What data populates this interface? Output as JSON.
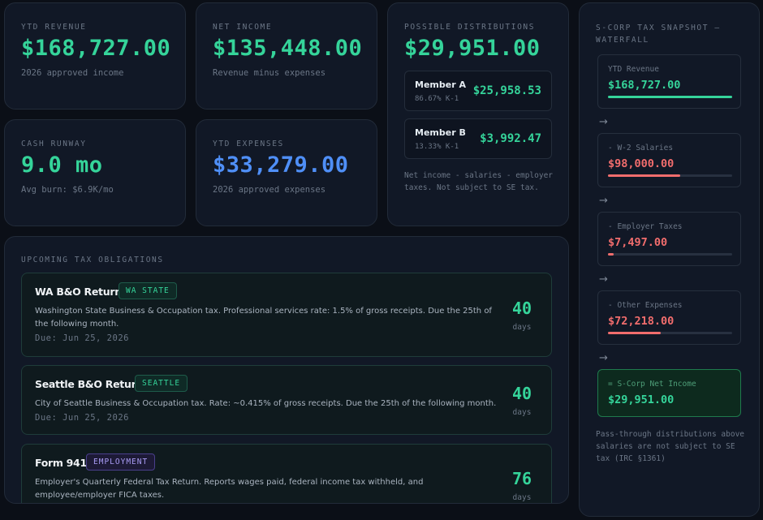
{
  "ytd_revenue": {
    "label": "YTD REVENUE",
    "value": "$168,727.00",
    "sub": "2026 approved income"
  },
  "net_income": {
    "label": "NET INCOME",
    "value": "$135,448.00",
    "sub": "Revenue minus expenses"
  },
  "cash_runway": {
    "label": "CASH RUNWAY",
    "value": "9.0 mo",
    "sub": "Avg burn: $6.9K/mo"
  },
  "ytd_expenses": {
    "label": "YTD EXPENSES",
    "value": "$33,279.00",
    "sub": "2026 approved expenses"
  },
  "distributions": {
    "label": "POSSIBLE DISTRIBUTIONS",
    "value": "$29,951.00",
    "members": [
      {
        "name": "Member A",
        "pct": "86.67% K-1",
        "amount": "$25,958.53"
      },
      {
        "name": "Member B",
        "pct": "13.33% K-1",
        "amount": "$3,992.47"
      }
    ],
    "note": "Net income - salaries - employer taxes. Not subject to SE tax."
  },
  "obligations": {
    "label": "UPCOMING TAX OBLIGATIONS",
    "items": [
      {
        "title": "WA B&O Return",
        "badge": "WA STATE",
        "desc": "Washington State Business & Occupation tax. Professional services rate: 1.5% of gross receipts. Due the 25th of the following month.",
        "due": "Due: Jun 25, 2026",
        "days": "40",
        "days_label": "days"
      },
      {
        "title": "Seattle B&O Return",
        "badge": "SEATTLE",
        "desc": "City of Seattle Business & Occupation tax. Rate: ~0.415% of gross receipts. Due the 25th of the following month.",
        "due": "Due: Jun 25, 2026",
        "days": "40",
        "days_label": "days"
      },
      {
        "title": "Form 941",
        "badge": "EMPLOYMENT",
        "desc": "Employer's Quarterly Federal Tax Return. Reports wages paid, federal income tax withheld, and employee/employer FICA taxes.",
        "due": "",
        "days": "76",
        "days_label": "days"
      }
    ]
  },
  "waterfall": {
    "title": "S-CORP TAX SNAPSHOT — WATERFALL",
    "arrow": "→",
    "steps": [
      {
        "label": "YTD Revenue",
        "value": "$168,727.00",
        "fraction": 1.0,
        "color": "#35d49a"
      },
      {
        "label": "- W-2 Salaries",
        "value": "$98,000.00",
        "fraction": 0.581,
        "color": "#f26d6d"
      },
      {
        "label": "- Employer Taxes",
        "value": "$7,497.00",
        "fraction": 0.044,
        "color": "#f26d6d"
      },
      {
        "label": "- Other Expenses",
        "value": "$72,218.00",
        "fraction": 0.428,
        "color": "#f26d6d"
      }
    ],
    "final": {
      "label": "= S-Corp Net Income",
      "value": "$29,951.00"
    },
    "note": "Pass-through distributions above salaries are not subject to SE tax (IRC §1361)"
  },
  "colors": {
    "accent": "#35d49a",
    "blue": "#4f8ff7",
    "negative": "#f26d6d",
    "background": "#0b0f17"
  }
}
